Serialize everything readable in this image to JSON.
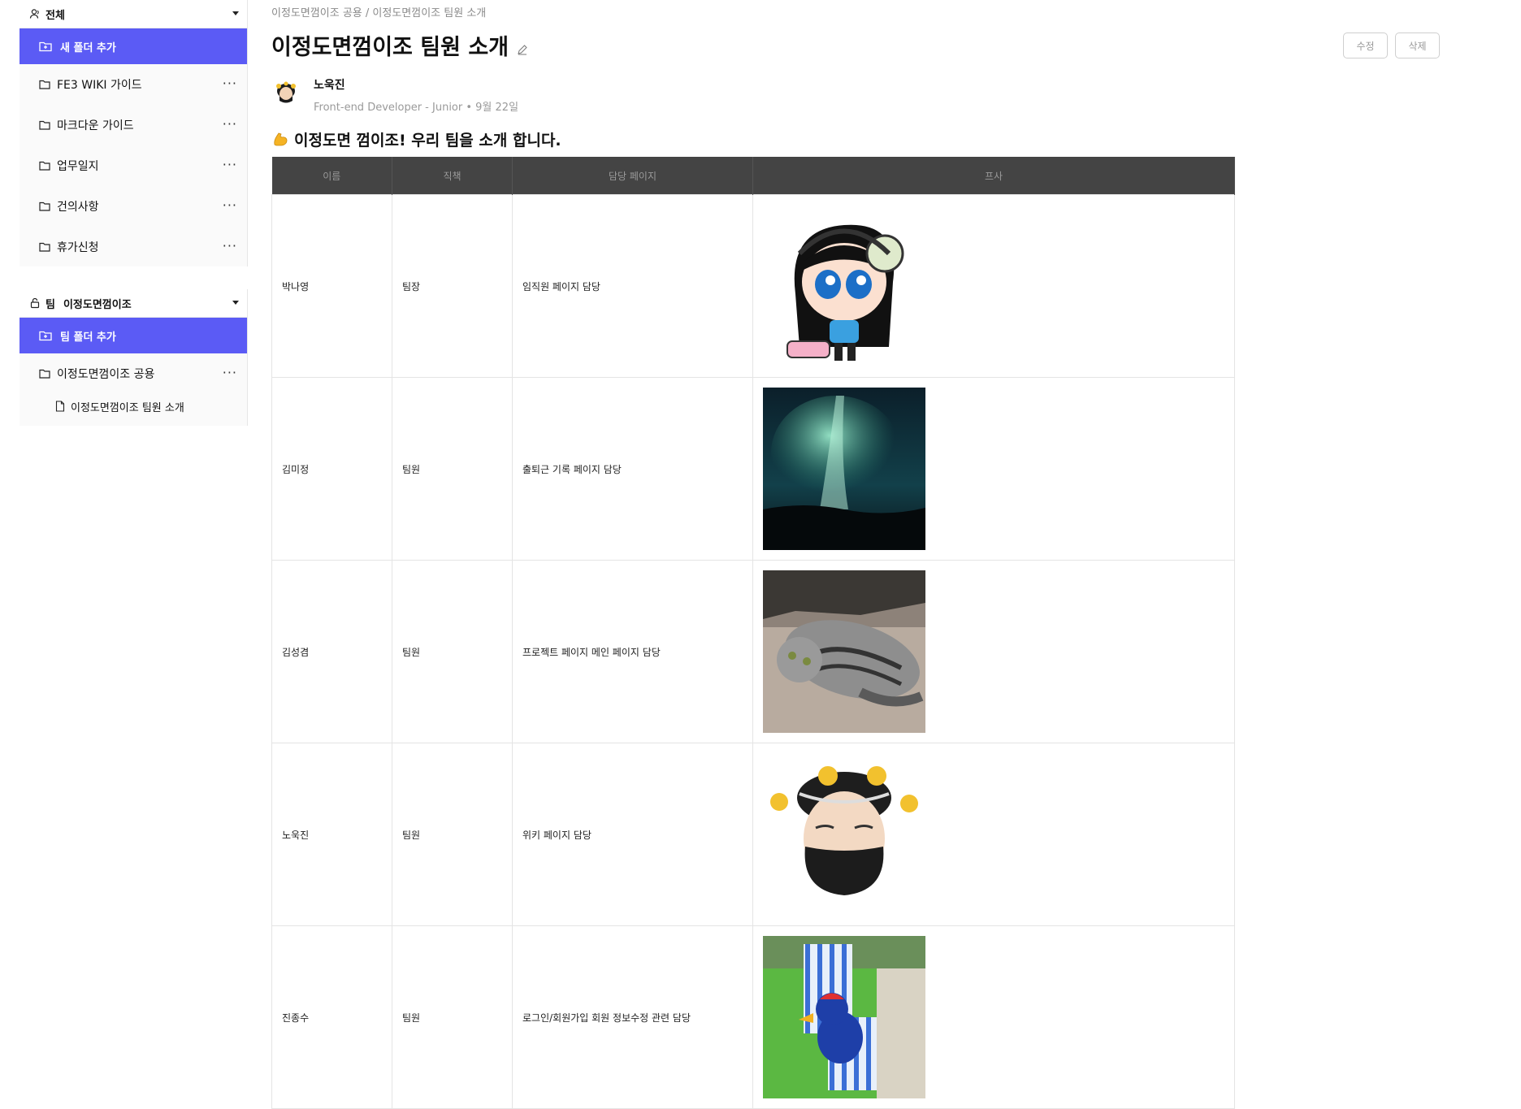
{
  "sidebar": {
    "all_group": {
      "label": "전체",
      "add_label": "새 폴더 추가",
      "folders": [
        {
          "label": "FE3 WIKI 가이드"
        },
        {
          "label": "마크다운 가이드"
        },
        {
          "label": "업무일지"
        },
        {
          "label": "건의사항"
        },
        {
          "label": "휴가신청"
        }
      ]
    },
    "team_group": {
      "prefix": "팀",
      "label": "이정도면껌이조",
      "add_label": "팀 폴더 추가",
      "folders": [
        {
          "label": "이정도면껌이조 공용"
        }
      ],
      "docs": [
        {
          "label": "이정도면껌이조 팀원 소개"
        }
      ]
    },
    "more_glyph": "···"
  },
  "breadcrumb": "이정도면껌이조 공용 / 이정도면껌이조 팀원 소개",
  "page_title": "이정도면껌이조 팀원 소개",
  "actions": {
    "edit": "수정",
    "delete": "삭제"
  },
  "author": {
    "name": "노욱진",
    "meta": "Front-end Developer - Junior • 9월 22일"
  },
  "section_heading": "이정도면 껌이조! 우리 팀을 소개 합니다.",
  "table": {
    "headers": [
      "이름",
      "직책",
      "담당 페이지",
      "프사"
    ],
    "rows": [
      {
        "name": "박나영",
        "role": "팀장",
        "page": "임직원 페이지 담당",
        "image": "cartoon-girl-headphones"
      },
      {
        "name": "김미정",
        "role": "팀원",
        "page": "출퇴근 기록 페이지 담당",
        "image": "aurora"
      },
      {
        "name": "김성겸",
        "role": "팀원",
        "page": "프로젝트 페이지 메인 페이지 담당",
        "image": "tabby-cat"
      },
      {
        "name": "노욱진",
        "role": "팀원",
        "page": "위키 페이지 담당",
        "image": "memoji-mask"
      },
      {
        "name": "진종수",
        "role": "팀원",
        "page": "로그인/회원가입 회원 정보수정 관련 담당",
        "image": "game-bird"
      }
    ]
  },
  "colors": {
    "accent": "#5b5bf5",
    "table_header_bg": "#444444"
  }
}
